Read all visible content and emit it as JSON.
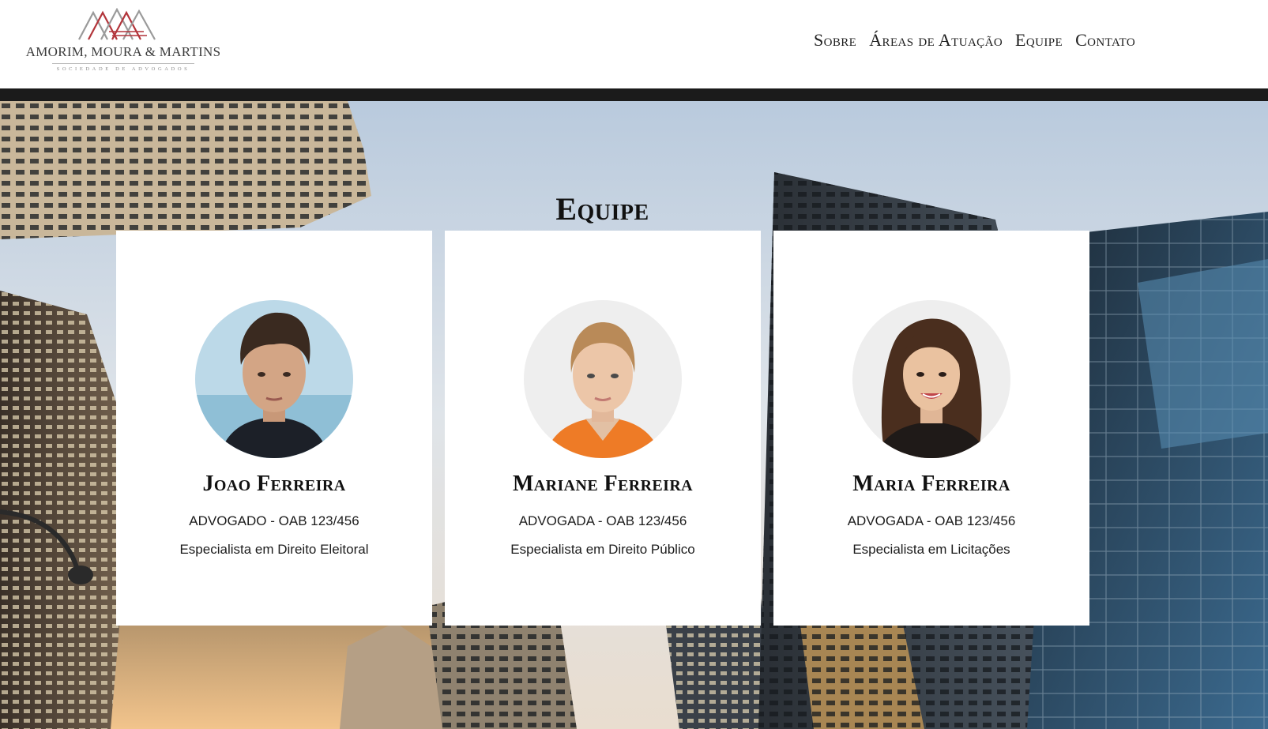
{
  "brand": {
    "name": "AMORIM, MOURA & MARTINS",
    "tagline": "SOCIEDADE DE ADVOGADOS",
    "colors": {
      "mark_red": "#b2343a",
      "mark_gray": "#9a9a9a",
      "text": "#3b3b3b"
    }
  },
  "nav": {
    "items": [
      {
        "label": "Sobre"
      },
      {
        "label": "Áreas de Atuação"
      },
      {
        "label": "Equipe"
      },
      {
        "label": "Contato"
      }
    ]
  },
  "section": {
    "title": "Equipe"
  },
  "team": [
    {
      "name": "Joao Ferreira",
      "role": "ADVOGADO - OAB 123/456",
      "specialty": "Especialista em Direito Eleitoral",
      "photo_icon": "portrait-man-icon"
    },
    {
      "name": "Mariane Ferreira",
      "role": "ADVOGADA - OAB 123/456",
      "specialty": "Especialista em Direito Público",
      "photo_icon": "portrait-woman-blonde-icon"
    },
    {
      "name": "Maria Ferreira",
      "role": "ADVOGADA - OAB 123/456",
      "specialty": "Especialista em Licitações",
      "photo_icon": "portrait-woman-brunette-icon"
    }
  ]
}
